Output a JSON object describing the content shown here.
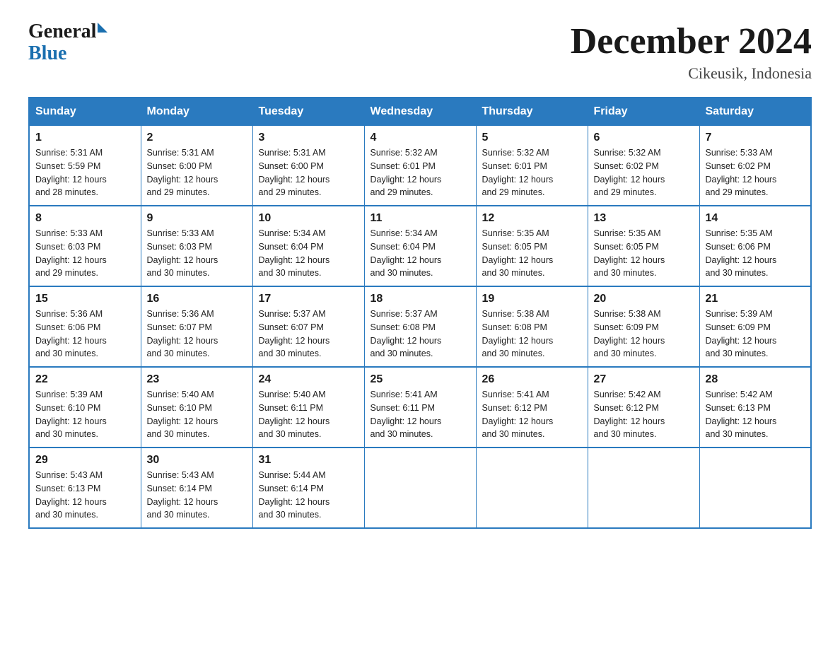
{
  "header": {
    "logo_general": "General",
    "logo_blue": "Blue",
    "month_title": "December 2024",
    "location": "Cikeusik, Indonesia"
  },
  "days_of_week": [
    "Sunday",
    "Monday",
    "Tuesday",
    "Wednesday",
    "Thursday",
    "Friday",
    "Saturday"
  ],
  "weeks": [
    [
      {
        "day": "1",
        "sunrise": "5:31 AM",
        "sunset": "5:59 PM",
        "daylight": "12 hours and 28 minutes."
      },
      {
        "day": "2",
        "sunrise": "5:31 AM",
        "sunset": "6:00 PM",
        "daylight": "12 hours and 29 minutes."
      },
      {
        "day": "3",
        "sunrise": "5:31 AM",
        "sunset": "6:00 PM",
        "daylight": "12 hours and 29 minutes."
      },
      {
        "day": "4",
        "sunrise": "5:32 AM",
        "sunset": "6:01 PM",
        "daylight": "12 hours and 29 minutes."
      },
      {
        "day": "5",
        "sunrise": "5:32 AM",
        "sunset": "6:01 PM",
        "daylight": "12 hours and 29 minutes."
      },
      {
        "day": "6",
        "sunrise": "5:32 AM",
        "sunset": "6:02 PM",
        "daylight": "12 hours and 29 minutes."
      },
      {
        "day": "7",
        "sunrise": "5:33 AM",
        "sunset": "6:02 PM",
        "daylight": "12 hours and 29 minutes."
      }
    ],
    [
      {
        "day": "8",
        "sunrise": "5:33 AM",
        "sunset": "6:03 PM",
        "daylight": "12 hours and 29 minutes."
      },
      {
        "day": "9",
        "sunrise": "5:33 AM",
        "sunset": "6:03 PM",
        "daylight": "12 hours and 30 minutes."
      },
      {
        "day": "10",
        "sunrise": "5:34 AM",
        "sunset": "6:04 PM",
        "daylight": "12 hours and 30 minutes."
      },
      {
        "day": "11",
        "sunrise": "5:34 AM",
        "sunset": "6:04 PM",
        "daylight": "12 hours and 30 minutes."
      },
      {
        "day": "12",
        "sunrise": "5:35 AM",
        "sunset": "6:05 PM",
        "daylight": "12 hours and 30 minutes."
      },
      {
        "day": "13",
        "sunrise": "5:35 AM",
        "sunset": "6:05 PM",
        "daylight": "12 hours and 30 minutes."
      },
      {
        "day": "14",
        "sunrise": "5:35 AM",
        "sunset": "6:06 PM",
        "daylight": "12 hours and 30 minutes."
      }
    ],
    [
      {
        "day": "15",
        "sunrise": "5:36 AM",
        "sunset": "6:06 PM",
        "daylight": "12 hours and 30 minutes."
      },
      {
        "day": "16",
        "sunrise": "5:36 AM",
        "sunset": "6:07 PM",
        "daylight": "12 hours and 30 minutes."
      },
      {
        "day": "17",
        "sunrise": "5:37 AM",
        "sunset": "6:07 PM",
        "daylight": "12 hours and 30 minutes."
      },
      {
        "day": "18",
        "sunrise": "5:37 AM",
        "sunset": "6:08 PM",
        "daylight": "12 hours and 30 minutes."
      },
      {
        "day": "19",
        "sunrise": "5:38 AM",
        "sunset": "6:08 PM",
        "daylight": "12 hours and 30 minutes."
      },
      {
        "day": "20",
        "sunrise": "5:38 AM",
        "sunset": "6:09 PM",
        "daylight": "12 hours and 30 minutes."
      },
      {
        "day": "21",
        "sunrise": "5:39 AM",
        "sunset": "6:09 PM",
        "daylight": "12 hours and 30 minutes."
      }
    ],
    [
      {
        "day": "22",
        "sunrise": "5:39 AM",
        "sunset": "6:10 PM",
        "daylight": "12 hours and 30 minutes."
      },
      {
        "day": "23",
        "sunrise": "5:40 AM",
        "sunset": "6:10 PM",
        "daylight": "12 hours and 30 minutes."
      },
      {
        "day": "24",
        "sunrise": "5:40 AM",
        "sunset": "6:11 PM",
        "daylight": "12 hours and 30 minutes."
      },
      {
        "day": "25",
        "sunrise": "5:41 AM",
        "sunset": "6:11 PM",
        "daylight": "12 hours and 30 minutes."
      },
      {
        "day": "26",
        "sunrise": "5:41 AM",
        "sunset": "6:12 PM",
        "daylight": "12 hours and 30 minutes."
      },
      {
        "day": "27",
        "sunrise": "5:42 AM",
        "sunset": "6:12 PM",
        "daylight": "12 hours and 30 minutes."
      },
      {
        "day": "28",
        "sunrise": "5:42 AM",
        "sunset": "6:13 PM",
        "daylight": "12 hours and 30 minutes."
      }
    ],
    [
      {
        "day": "29",
        "sunrise": "5:43 AM",
        "sunset": "6:13 PM",
        "daylight": "12 hours and 30 minutes."
      },
      {
        "day": "30",
        "sunrise": "5:43 AM",
        "sunset": "6:14 PM",
        "daylight": "12 hours and 30 minutes."
      },
      {
        "day": "31",
        "sunrise": "5:44 AM",
        "sunset": "6:14 PM",
        "daylight": "12 hours and 30 minutes."
      },
      null,
      null,
      null,
      null
    ]
  ],
  "labels": {
    "sunrise": "Sunrise:",
    "sunset": "Sunset:",
    "daylight": "Daylight:"
  }
}
